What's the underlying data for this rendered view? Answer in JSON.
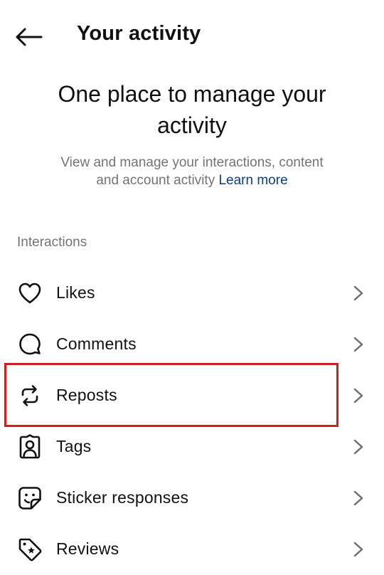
{
  "header": {
    "title": "Your activity"
  },
  "hero": {
    "heading": "One place to manage your activity",
    "description": "View and manage your interactions, content and account activity",
    "learn_more": "Learn more"
  },
  "section": {
    "label": "Interactions"
  },
  "items": [
    {
      "label": "Likes",
      "icon": "heart-icon"
    },
    {
      "label": "Comments",
      "icon": "comment-bubble-icon"
    },
    {
      "label": "Reposts",
      "icon": "repost-icon"
    },
    {
      "label": "Tags",
      "icon": "tag-person-icon"
    },
    {
      "label": "Sticker responses",
      "icon": "sticker-icon"
    },
    {
      "label": "Reviews",
      "icon": "review-tag-icon"
    }
  ],
  "colors": {
    "highlight": "#d0201c",
    "link": "#0b3e7e",
    "secondary_text": "#737373"
  }
}
